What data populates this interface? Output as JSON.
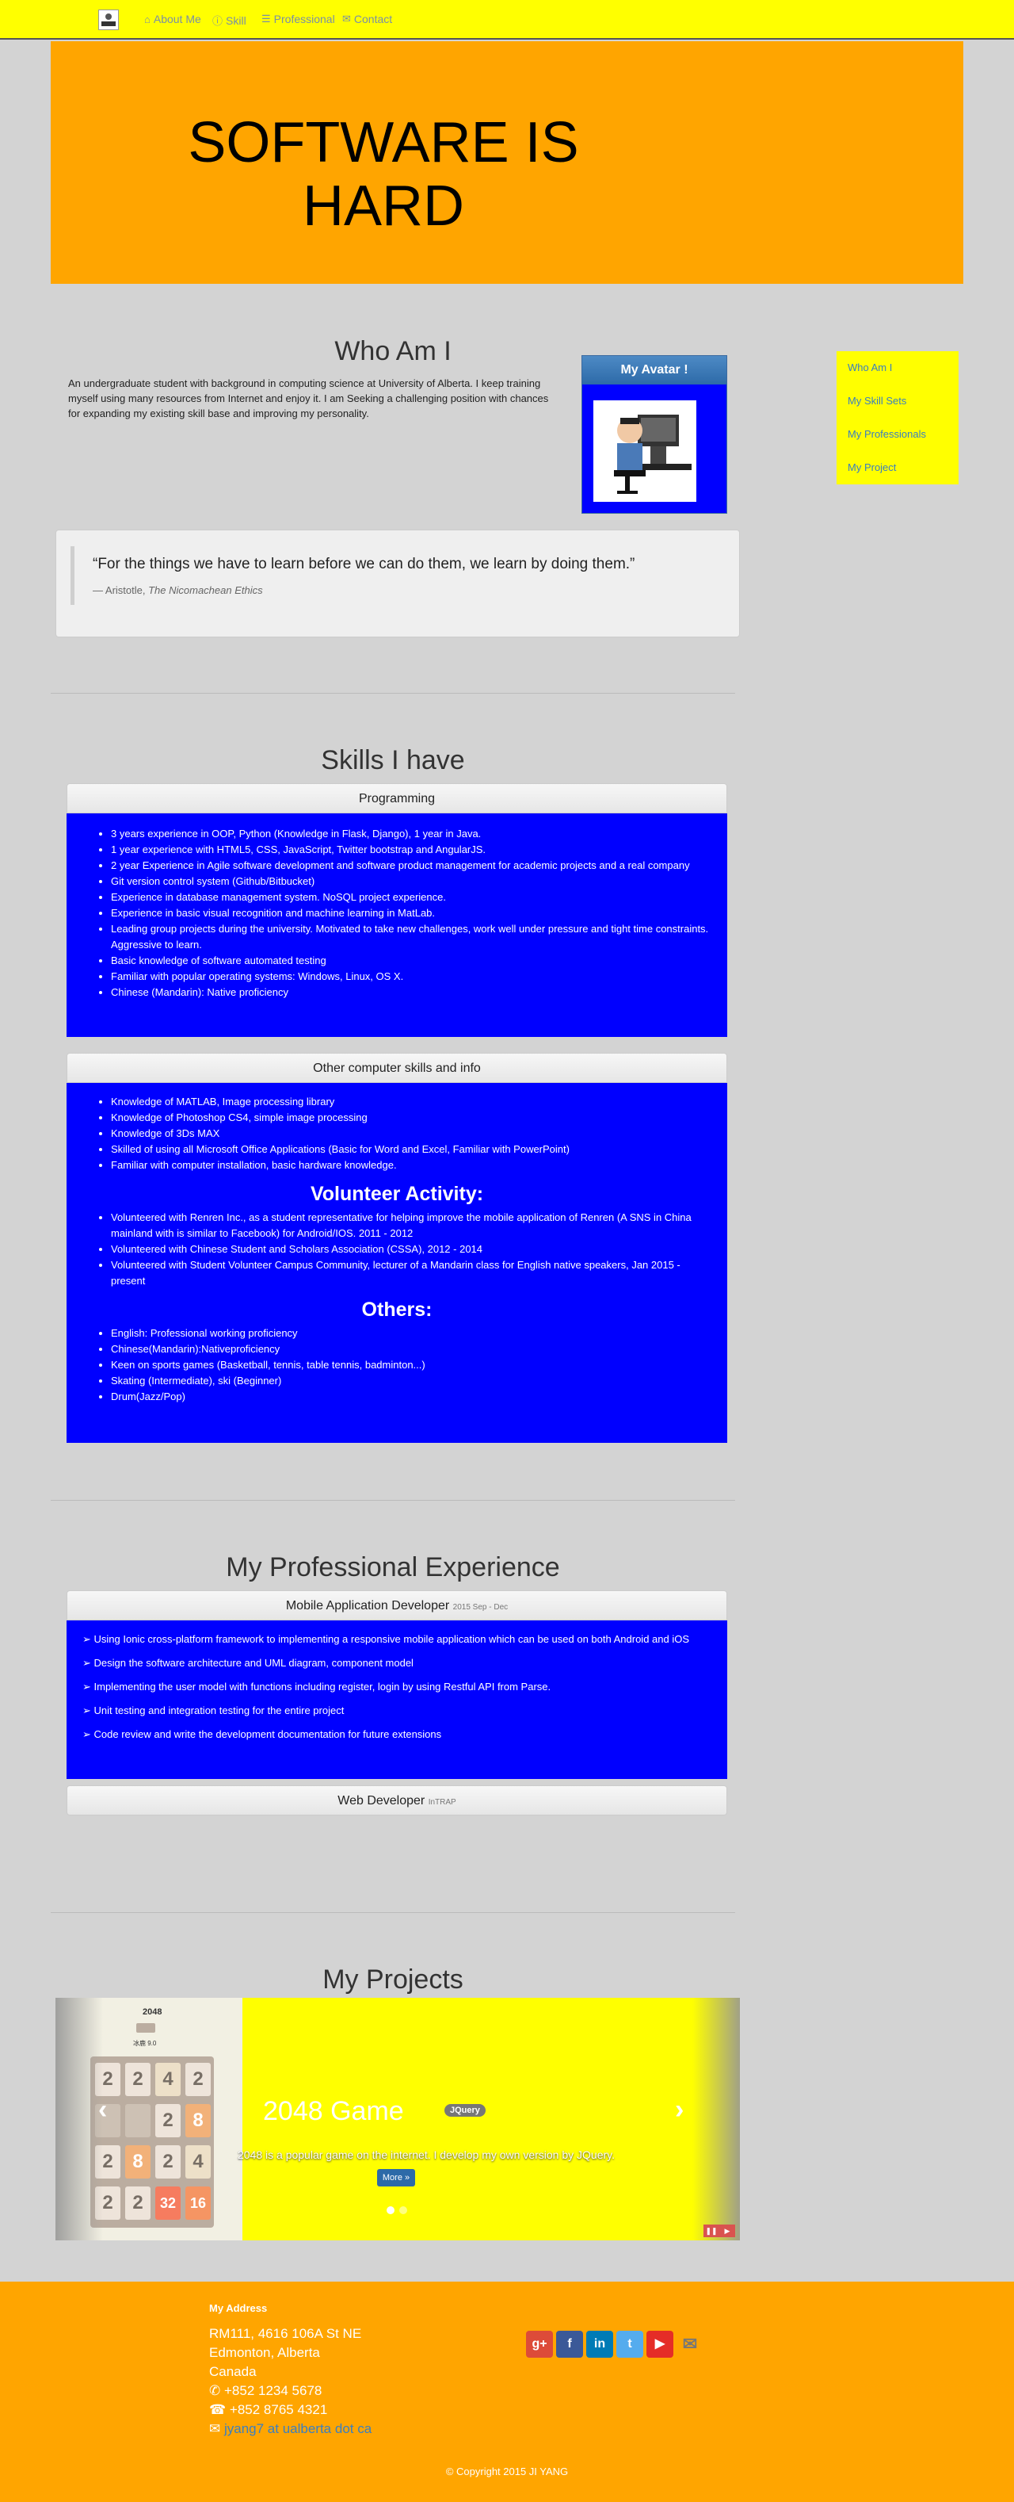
{
  "nav": {
    "items": [
      {
        "label": "About Me",
        "icon": "home-icon"
      },
      {
        "label": "Skill",
        "icon": "info-icon"
      },
      {
        "label": "Professional",
        "icon": "list-icon"
      },
      {
        "label": "Contact",
        "icon": "envelope-icon"
      }
    ]
  },
  "hero": {
    "title": "SOFTWARE IS HARD"
  },
  "whoami": {
    "title": "Who Am I",
    "text": "An undergraduate student with background in computing science at University of Alberta. I keep training myself using many resources from Internet and enjoy it. I am Seeking a challenging position with chances for expanding my existing skill base and improving my personality.",
    "avatar_label": "My Avatar !"
  },
  "side_nav": [
    "Who Am I",
    "My Skill Sets",
    "My Professionals",
    "My Project"
  ],
  "quote": {
    "text": "“For the things we have to learn before we can do them, we learn by doing them.”",
    "source_prefix": "— Aristotle,",
    "source_title": "The Nicomachean Ethics"
  },
  "skills": {
    "title": "Skills I have",
    "programming_head": "Programming",
    "programming": [
      "3 years experience in OOP, Python (Knowledge in Flask, Django), 1 year in Java.",
      "1 year experience with HTML5, CSS, JavaScript, Twitter bootstrap and AngularJS.",
      "2 year Experience in Agile software development and software product management for academic projects and a real company",
      "Git version control system (Github/Bitbucket)",
      "Experience in database management system. NoSQL project experience.",
      "Experience in basic visual recognition and machine learning in MatLab.",
      "Leading group projects during the university. Motivated to take new challenges, work well under pressure and tight time constraints. Aggressive to learn.",
      "Basic knowledge of software automated testing",
      "Familiar with popular operating systems: Windows, Linux, OS X.",
      "Chinese (Mandarin): Native proficiency"
    ],
    "other_head": "Other computer skills and info",
    "other": [
      "Knowledge of MATLAB, Image processing library",
      "Knowledge of Photoshop CS4, simple image processing",
      "Knowledge of 3Ds MAX",
      "Skilled of using all Microsoft Office Applications (Basic for Word and Excel, Familiar with PowerPoint)",
      "Familiar with computer installation, basic hardware knowledge."
    ],
    "volunteer_title": "Volunteer Activity:",
    "volunteer": [
      "Volunteered with Renren Inc., as a student representative for helping improve the mobile application of Renren (A SNS in China mainland with is similar to Facebook) for Android/IOS. 2011 - 2012",
      "Volunteered with Chinese Student and Scholars Association (CSSA), 2012 - 2014",
      "Volunteered with Student Volunteer Campus Community, lecturer of a Mandarin class for English native speakers, Jan 2015 - present"
    ],
    "others_title": "Others:",
    "others": [
      "English: Professional working proficiency",
      "Chinese(Mandarin):Nativeproficiency",
      "Keen on sports games (Basketball, tennis, table tennis, badminton...)",
      "Skating (Intermediate), ski (Beginner)",
      "Drum(Jazz/Pop)"
    ]
  },
  "professional": {
    "title": "My Professional Experience",
    "job1_title": "Mobile Application Developer",
    "job1_date": "2015 Sep - Dec",
    "job1_points": [
      "➢ Using Ionic cross-platform framework to implementing a responsive mobile application which can be used on both Android and iOS",
      "➢ Design the software architecture and UML diagram, component model",
      "➢ Implementing the user model with functions including register, login by using Restful API from Parse.",
      "➢ Unit testing and integration testing for the entire project",
      "➢ Code review and write the development documentation for future extensions"
    ],
    "job2_title": "Web Developer",
    "job2_date": "InTRAP"
  },
  "projects": {
    "title": "My Projects",
    "slide_title": "2048 Game",
    "slide_badge": "JQuery",
    "slide_text": "2048 is a popular game on the internet. I develop my own version by JQuery.",
    "more_label": "More »",
    "game_title": "2048",
    "game_sub": "冰鹿 9.0",
    "tiles": [
      "2",
      "2",
      "4",
      "2",
      "",
      "",
      "2",
      "8",
      "2",
      "8",
      "2",
      "4",
      "2",
      "2",
      "32",
      "16"
    ]
  },
  "footer": {
    "label": "My Address",
    "line1": "RM111, 4616 106A St NE",
    "line2": "Edmonton, Alberta",
    "line3": "Canada",
    "phone": "+852 1234 5678",
    "fax": "+852 8765 4321",
    "email": "jyang7 at ualberta dot ca",
    "copyright": "© Copyright 2015 JI YANG",
    "social": [
      "google-plus",
      "facebook",
      "linkedin",
      "twitter",
      "youtube",
      "mail"
    ]
  },
  "colors": {
    "navbar": "#ffff00",
    "hero": "#ffa500",
    "panel": "#0000ff",
    "side_nav": "#ffff00",
    "footer": "#ffa500"
  }
}
